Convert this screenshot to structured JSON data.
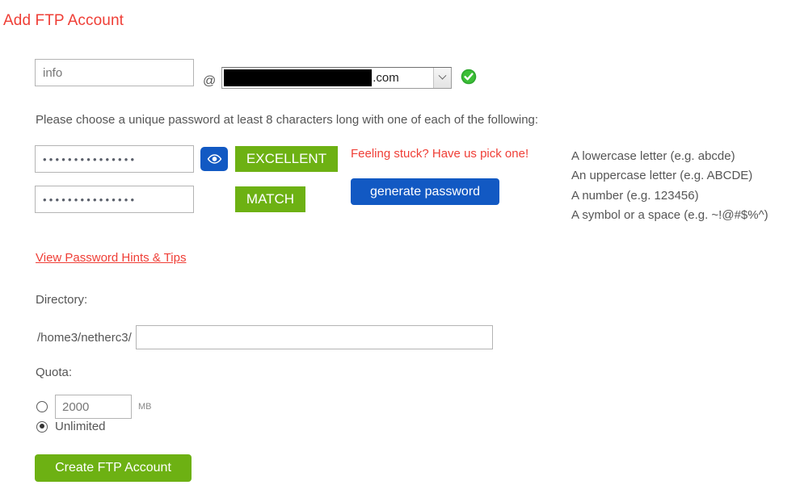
{
  "page": {
    "title": "Add FTP Account",
    "title_color": "#ef3e36"
  },
  "login": {
    "username_value": "info",
    "username_placeholder": "",
    "at_symbol": "@",
    "domain_redacted": true,
    "domain_tld": ".com",
    "domain_icon": "chevron-down-icon",
    "validity_icon": "green-check-circle-icon"
  },
  "password": {
    "instructions": "Please choose a unique password at least 8 characters long with one of each of the following:",
    "field1_value": "•••••••••••••••",
    "field2_value": "•••••••••••••••",
    "show_password_icon": "eye-icon",
    "strength_badge": "EXCELLENT",
    "match_badge": "MATCH",
    "stuck_text": "Feeling stuck? Have us pick one!",
    "generate_label": "generate password",
    "requirements": [
      "A lowercase letter (e.g. abcde)",
      "An uppercase letter (e.g. ABCDE)",
      "A number (e.g. 123456)",
      "A symbol or a space (e.g. ~!@#$%^)"
    ],
    "hints_link": "View Password Hints & Tips",
    "badge_color": "#6db113",
    "accent_blue": "#1259c3"
  },
  "directory": {
    "label": "Directory:",
    "prefix": "/home3/netherc3/",
    "value": "",
    "placeholder": ""
  },
  "quota": {
    "label": "Quota:",
    "mb_value": "2000",
    "mb_unit": "MB",
    "mb_selected": false,
    "unlimited_label": "Unlimited",
    "unlimited_selected": true
  },
  "submit": {
    "label": "Create FTP Account",
    "color": "#6db113"
  }
}
